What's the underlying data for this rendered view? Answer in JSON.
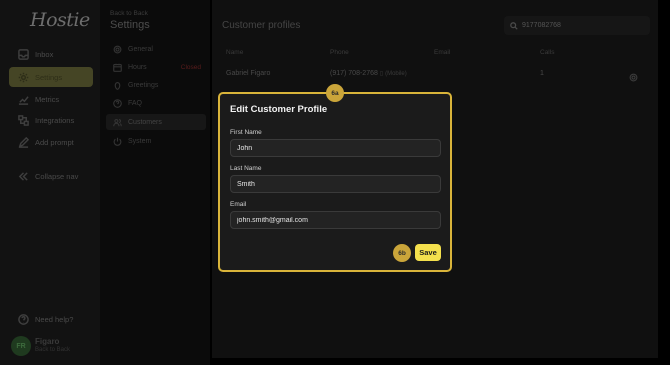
{
  "brand": {
    "logo_text": "Hostie"
  },
  "nav": {
    "items": [
      {
        "label": "Inbox",
        "icon": "inbox-icon",
        "active": false
      },
      {
        "label": "Settings",
        "icon": "gear-icon",
        "active": true
      },
      {
        "label": "Metrics",
        "icon": "chart-icon",
        "active": false
      },
      {
        "label": "Integrations",
        "icon": "integrations-icon",
        "active": false
      },
      {
        "label": "Add prompt",
        "icon": "pencil-icon",
        "active": false
      },
      {
        "label": "Collapse nav",
        "icon": "collapse-icon",
        "active": false
      }
    ],
    "help_label": "Need help?",
    "user": {
      "initials": "FR",
      "name": "Figaro",
      "subtitle": "Back to Back"
    }
  },
  "settings": {
    "back_label": "Back to Back",
    "title": "Settings",
    "items": [
      {
        "label": "General",
        "icon": "gear-icon"
      },
      {
        "label": "Hours",
        "icon": "calendar-icon",
        "tag": "Closed"
      },
      {
        "label": "Greetings",
        "icon": "wave-icon"
      },
      {
        "label": "FAQ",
        "icon": "question-icon"
      },
      {
        "label": "Customers",
        "icon": "users-icon",
        "active": true
      },
      {
        "label": "System",
        "icon": "power-icon"
      }
    ]
  },
  "main": {
    "title": "Customer profiles",
    "search": {
      "value": "9177082768"
    },
    "columns": [
      "Name",
      "Phone",
      "Email",
      "Calls"
    ],
    "rows": [
      {
        "name": "Gabriel Figaro",
        "phone": "(917) 708-2768",
        "phone_type": "Mobile",
        "email": "",
        "calls": "1"
      }
    ]
  },
  "modal": {
    "title": "Edit Customer Profile",
    "badge_top": "6a",
    "badge_bottom": "6b",
    "first_name_label": "First Name",
    "first_name_value": "John",
    "last_name_label": "Last Name",
    "last_name_value": "Smith",
    "email_label": "Email",
    "email_value": "john.smith@gmail.com",
    "save_label": "Save"
  },
  "colors": {
    "accent": "#f4e04d",
    "modal_border": "#d9b43a",
    "badge": "#caa53a",
    "closed_tag": "#5a1c1c"
  }
}
